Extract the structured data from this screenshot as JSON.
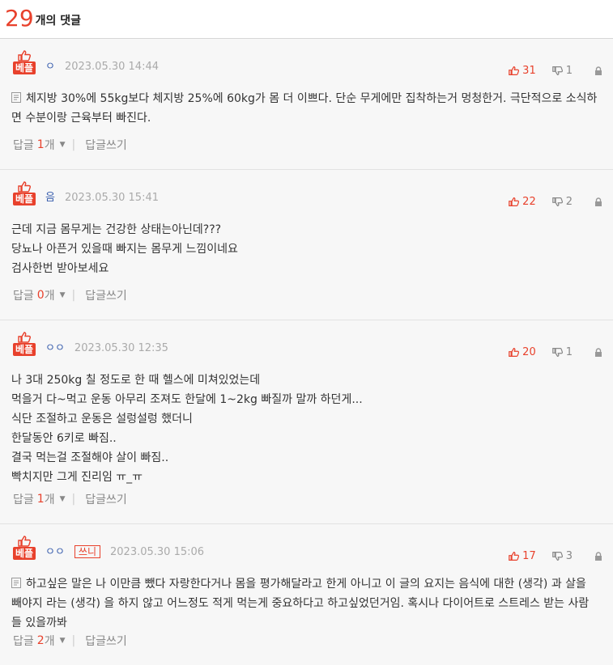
{
  "header": {
    "count": "29",
    "label": "개의 댓글"
  },
  "badge_label": "베플",
  "actions": {
    "reply_label": "답글",
    "count_suffix": "개",
    "write_label": "답글쓰기"
  },
  "comments": [
    {
      "author": "ㅇ",
      "writer_tag": "",
      "date": "2023.05.30 14:44",
      "up": "31",
      "down": "1",
      "memo": true,
      "lines": [
        "체지방 30%에 55kg보다 체지방 25%에 60kg가 몸 더 이쁘다. 단순 무게에만 집착하는거 멍청한거. 극단적으로 소식하면 수분이랑 근육부터 빠진다."
      ],
      "reply_count": "1"
    },
    {
      "author": "음",
      "writer_tag": "",
      "date": "2023.05.30 15:41",
      "up": "22",
      "down": "2",
      "memo": false,
      "lines": [
        "근데 지금 몸무게는 건강한 상태는아닌데???",
        "당뇨나 아픈거 있을때 빠지는 몸무게 느낌이네요",
        "검사한번 받아보세요"
      ],
      "reply_count": "0"
    },
    {
      "author": "ㅇㅇ",
      "writer_tag": "",
      "date": "2023.05.30 12:35",
      "up": "20",
      "down": "1",
      "memo": false,
      "lines": [
        "나 3대 250kg 칠 정도로 한 때 헬스에 미쳐있었는데",
        "먹을거 다~먹고 운동 아무리 조져도 한달에 1~2kg 빠질까 말까 하던게...",
        "식단 조절하고 운동은 설렁설렁 했더니",
        "한달동안 6키로 빠짐..",
        "결국 먹는걸 조절해야 살이 빠짐..",
        "빡치지만 그게 진리임 ㅠ_ㅠ"
      ],
      "reply_count": "1"
    },
    {
      "author": "ㅇㅇ",
      "writer_tag": "쓰니",
      "date": "2023.05.30 15:06",
      "up": "17",
      "down": "3",
      "memo": true,
      "lines": [
        "하고싶은 말은 나 이만큼 뺐다 자랑한다거나 몸을 평가해달라고 한게 아니고 이 글의 요지는 음식에 대한 (생각) 과 살을 빼야지 라는 (생각) 을 하지 않고 어느정도 적게 먹는게 중요하다고 하고싶었던거임. 혹시나 다이어트로 스트레스 받는 사람들 있을까봐"
      ],
      "reply_count": "2"
    }
  ],
  "colors": {
    "accent": "#e8412c",
    "author": "#3a5fae",
    "muted": "#aaaaaa"
  }
}
